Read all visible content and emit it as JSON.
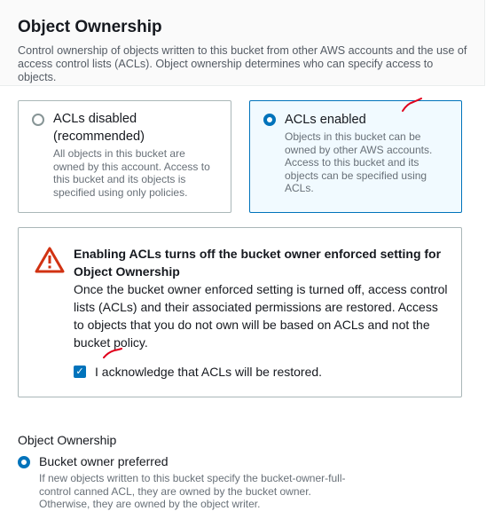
{
  "section": {
    "title": "Object Ownership",
    "description": "Control ownership of objects written to this bucket from other AWS accounts and the use of access control lists (ACLs). Object ownership determines who can specify access to objects."
  },
  "options": [
    {
      "label": "ACLs disabled (recommended)",
      "description": "All objects in this bucket are owned by this account. Access to this bucket and its objects is specified using only policies.",
      "selected": false
    },
    {
      "label": "ACLs enabled",
      "description": "Objects in this bucket can be owned by other AWS accounts. Access to this bucket and its objects can be specified using ACLs.",
      "selected": true
    }
  ],
  "warning": {
    "title": "Enabling ACLs turns off the bucket owner enforced setting for Object Ownership",
    "body": "Once the bucket owner enforced setting is turned off, access control lists (ACLs) and their associated permissions are restored. Access to objects that you do not own will be based on ACLs and not the bucket policy.",
    "checkbox_label": "I acknowledge that ACLs will be restored.",
    "checkbox_checked": true,
    "icon": "warning-triangle-icon",
    "icon_color": "#d13212"
  },
  "object_ownership": {
    "label": "Object Ownership",
    "option_label": "Bucket owner preferred",
    "option_description": "If new objects written to this bucket specify the bucket-owner-full-control canned ACL, they are owned by the bucket owner. Otherwise, they are owned by the object writer."
  },
  "colors": {
    "accent": "#0073bb",
    "annotation": "#e0001b"
  }
}
